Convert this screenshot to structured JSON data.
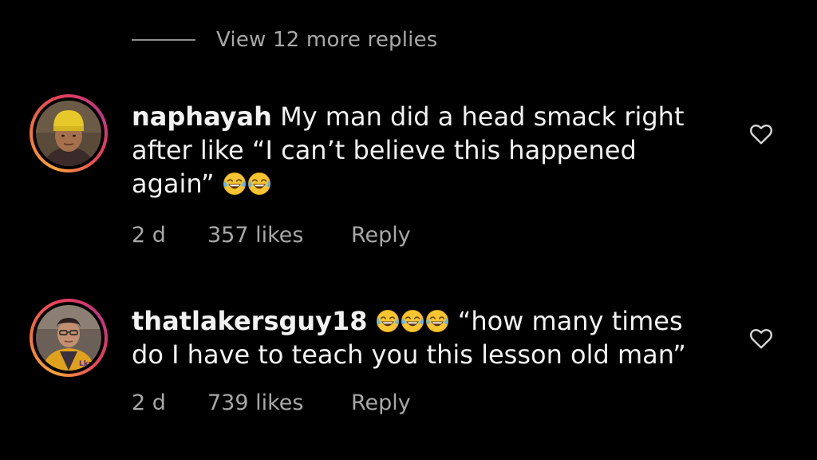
{
  "view_more": {
    "label": "View 12 more replies"
  },
  "comments": [
    {
      "username": "naphayah",
      "text_line1": " My man did a head smack right",
      "text_line2": "after like “I can’t believe this happened",
      "text_line3": "again” ",
      "emoji_after_text": [
        "face-with-tears-of-joy",
        "face-with-tears-of-joy"
      ],
      "time": "2 d",
      "likes": "357 likes",
      "reply_label": "Reply"
    },
    {
      "username": "thatlakersguy18",
      "emoji_after_username": [
        "face-with-tears-of-joy",
        "face-with-tears-of-joy",
        "face-with-tears-of-joy"
      ],
      "text_line1": " “how many times",
      "text_line2": "do I have to teach you this lesson old man”",
      "time": "2 d",
      "likes": "739 likes",
      "reply_label": "Reply"
    }
  ],
  "colors": {
    "background": "#000000",
    "text": "#f2f2f2",
    "muted": "#a8a8a8",
    "ring_start": "#f9a33a",
    "ring_end": "#c13584"
  },
  "icons": [
    "heart-outline-icon",
    "face-with-tears-of-joy-emoji"
  ]
}
